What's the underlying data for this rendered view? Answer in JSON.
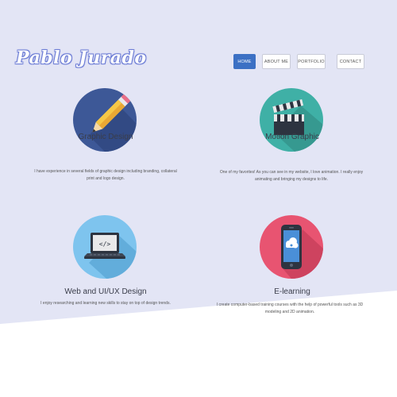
{
  "brand": {
    "logo": "Pablo Jurado"
  },
  "nav": {
    "items": [
      {
        "label": "HOME",
        "active": true
      },
      {
        "label": "ABOUT ME",
        "active": false
      },
      {
        "label": "PORTFOLIO",
        "active": false
      },
      {
        "label": "CONTACT",
        "active": false
      }
    ]
  },
  "services": [
    {
      "title": "Graphic Design",
      "icon": "pencil-icon",
      "color": "#3d5897",
      "description": "I have experience in several fields of graphic design including branding, collateral print and logo design."
    },
    {
      "title": "Motion Graphic",
      "icon": "clapperboard-icon",
      "color": "#3fb0a6",
      "description": "One of my favorites! As you can see in my website, I love animation. I really enjoy animating and bringing my designs to life."
    },
    {
      "title": "Web and UI/UX Design",
      "icon": "laptop-code-icon",
      "color": "#7ec4ee",
      "description": "I enjoy researching and learning new skills to stay on top of design trends."
    },
    {
      "title": "E-learning",
      "icon": "tablet-cloud-icon",
      "color": "#e85471",
      "description": "I create computer-based training courses with the help of powerful tools such as 3D modeling and 2D animation."
    }
  ],
  "colors": {
    "background": "#e3e5f5",
    "accent": "#3c70c4",
    "lower": "#ffffff"
  }
}
